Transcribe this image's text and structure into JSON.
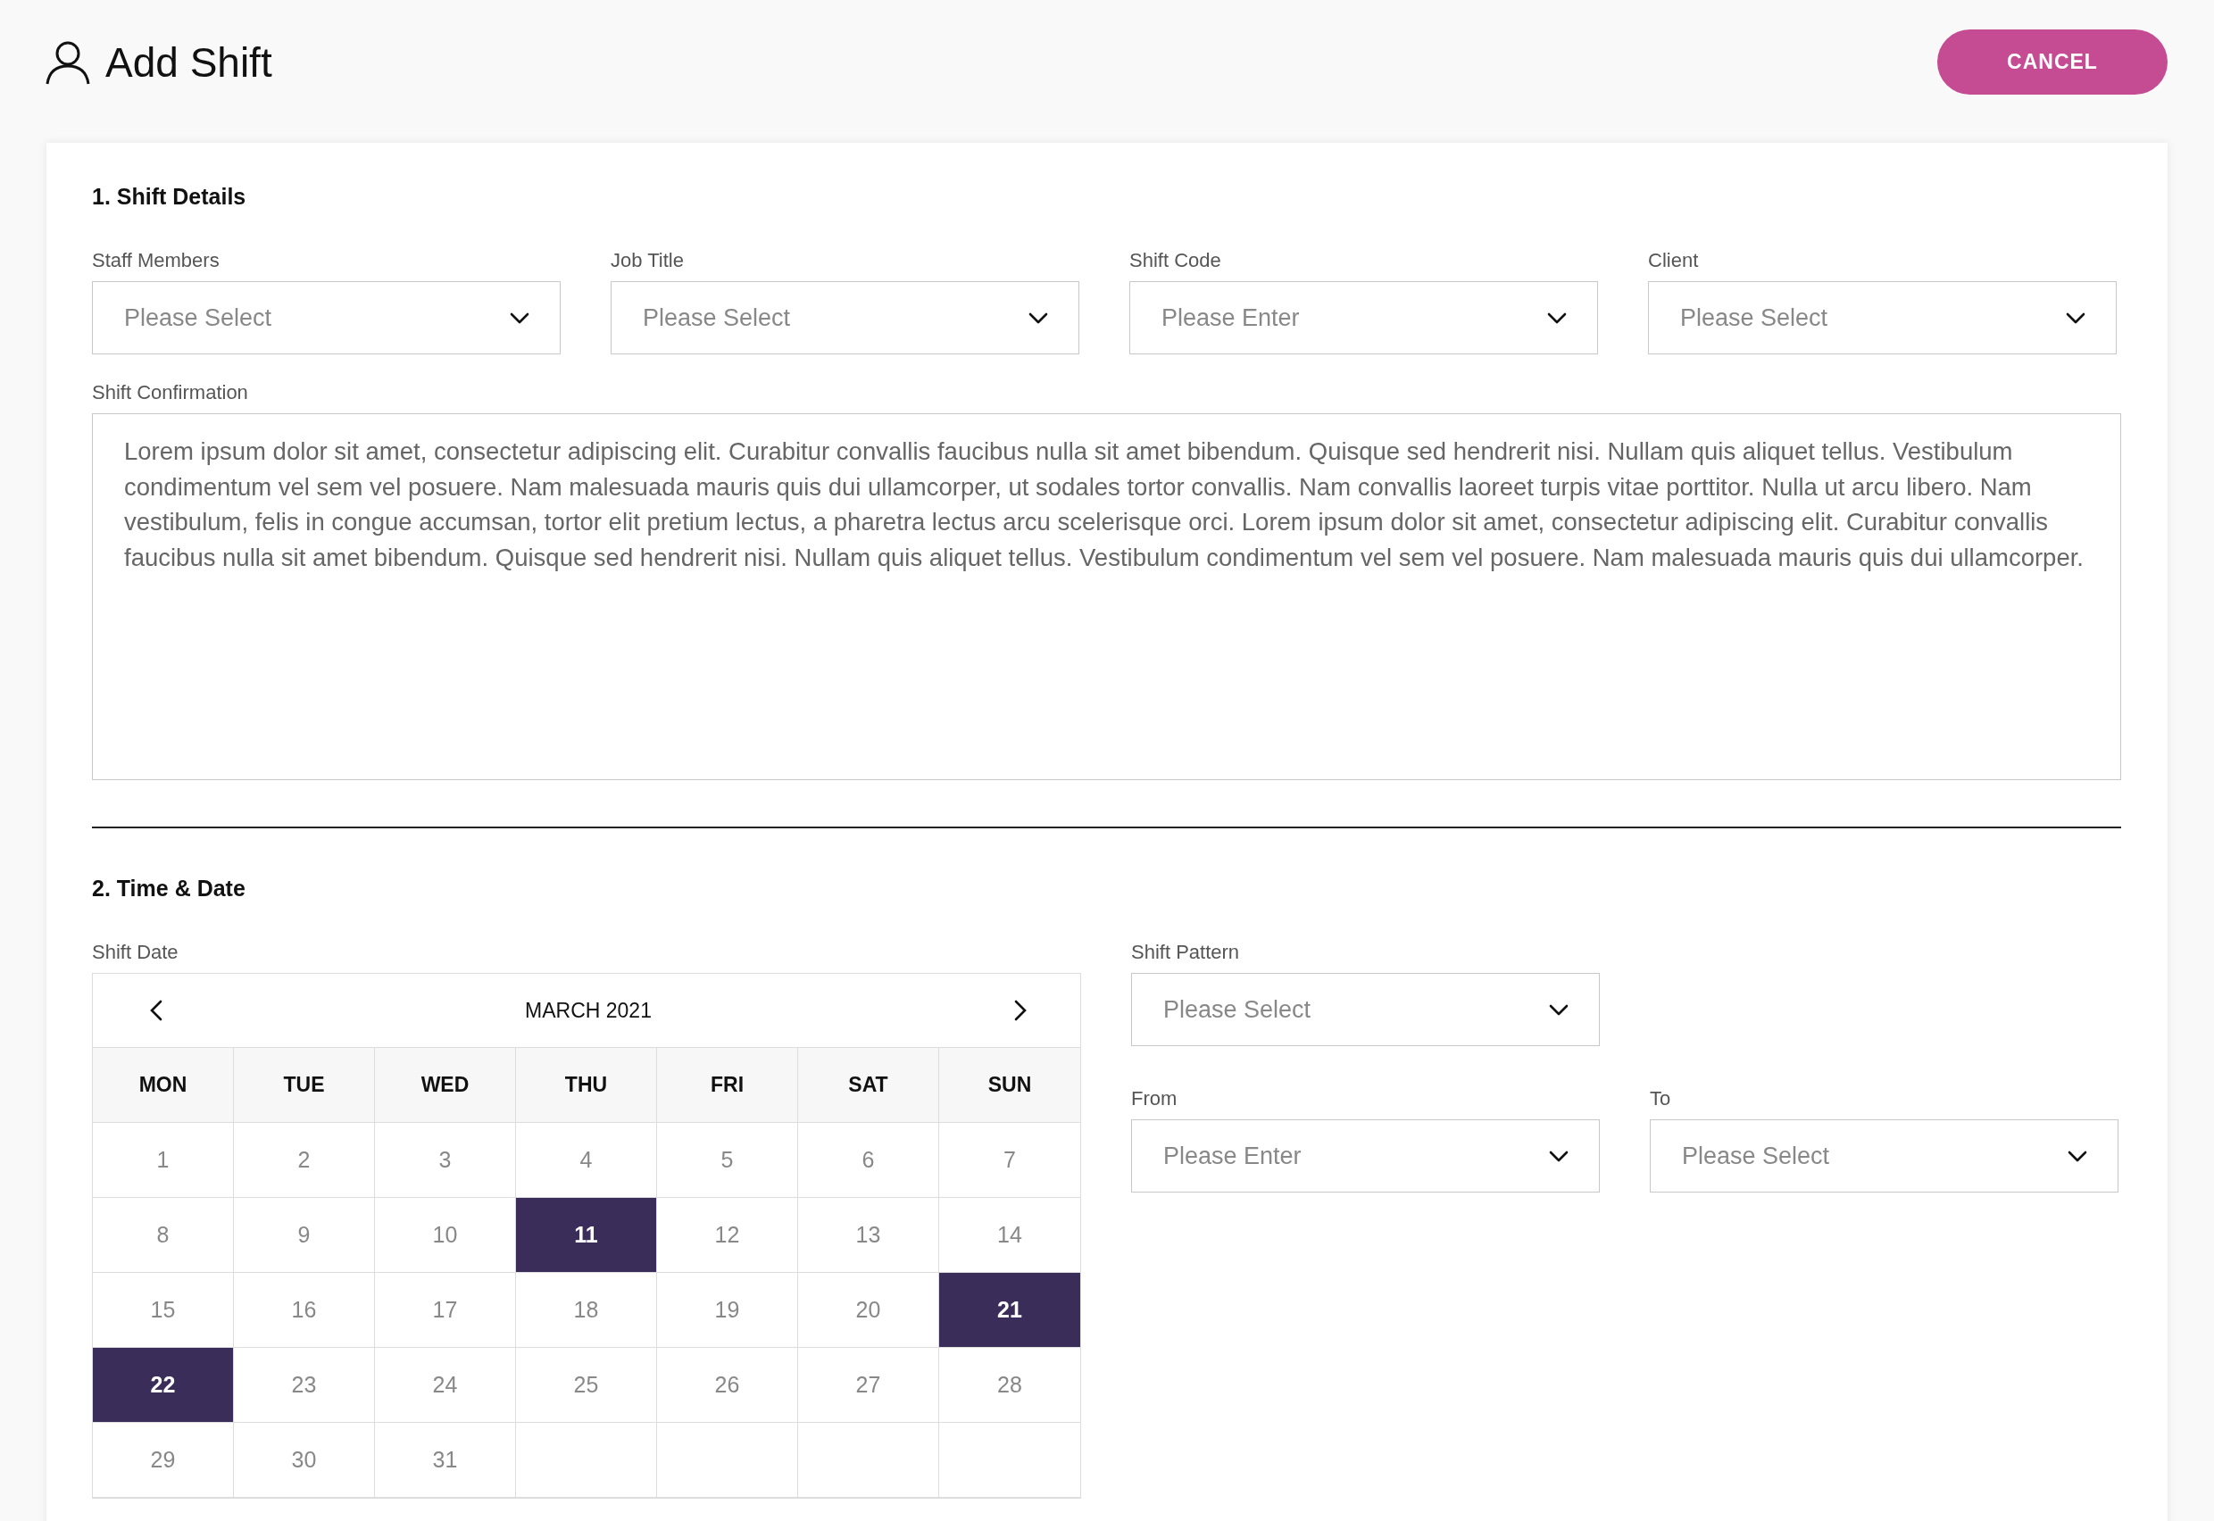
{
  "header": {
    "title": "Add Shift",
    "cancel_button": "CANCEL"
  },
  "shift_details": {
    "title": "1. Shift Details",
    "fields": [
      {
        "label": "Staff Members",
        "placeholder": "Please Select"
      },
      {
        "label": "Job Title",
        "placeholder": "Please Select"
      },
      {
        "label": "Shift Code",
        "placeholder": "Please Enter"
      },
      {
        "label": "Client",
        "placeholder": "Please Select"
      }
    ],
    "confirmation": {
      "label": "Shift Confirmation",
      "value": "Lorem ipsum dolor sit amet, consectetur adipiscing elit. Curabitur convallis faucibus nulla sit amet bibendum. Quisque sed hendrerit nisi. Nullam quis aliquet tellus. Vestibulum condimentum vel sem vel posuere. Nam malesuada mauris quis dui ullamcorper, ut sodales tortor convallis. Nam convallis laoreet turpis vitae porttitor. Nulla ut arcu libero. Nam vestibulum, felis in congue accumsan, tortor elit pretium lectus, a pharetra lectus arcu scelerisque orci. Lorem ipsum dolor sit amet, consectetur adipiscing elit. Curabitur convallis faucibus nulla sit amet bibendum. Quisque sed hendrerit nisi. Nullam quis aliquet tellus. Vestibulum condimentum vel sem vel posuere. Nam malesuada mauris quis dui ullamcorper."
    }
  },
  "time_date": {
    "title": "2. Time & Date",
    "calendar": {
      "label": "Shift Date",
      "month": "MARCH 2021",
      "weekdays": [
        "MON",
        "TUE",
        "WED",
        "THU",
        "FRI",
        "SAT",
        "SUN"
      ],
      "weeks": [
        [
          {
            "day": "1",
            "selected": false
          },
          {
            "day": "2",
            "selected": false
          },
          {
            "day": "3",
            "selected": false
          },
          {
            "day": "4",
            "selected": false
          },
          {
            "day": "5",
            "selected": false
          },
          {
            "day": "6",
            "selected": false
          },
          {
            "day": "7",
            "selected": false
          }
        ],
        [
          {
            "day": "8",
            "selected": false
          },
          {
            "day": "9",
            "selected": false
          },
          {
            "day": "10",
            "selected": false
          },
          {
            "day": "11",
            "selected": true
          },
          {
            "day": "12",
            "selected": false
          },
          {
            "day": "13",
            "selected": false
          },
          {
            "day": "14",
            "selected": false
          }
        ],
        [
          {
            "day": "15",
            "selected": false
          },
          {
            "day": "16",
            "selected": false
          },
          {
            "day": "17",
            "selected": false
          },
          {
            "day": "18",
            "selected": false
          },
          {
            "day": "19",
            "selected": false
          },
          {
            "day": "20",
            "selected": false
          },
          {
            "day": "21",
            "selected": true
          }
        ],
        [
          {
            "day": "22",
            "selected": true
          },
          {
            "day": "23",
            "selected": false
          },
          {
            "day": "24",
            "selected": false
          },
          {
            "day": "25",
            "selected": false
          },
          {
            "day": "26",
            "selected": false
          },
          {
            "day": "27",
            "selected": false
          },
          {
            "day": "28",
            "selected": false
          }
        ],
        [
          {
            "day": "29",
            "selected": false
          },
          {
            "day": "30",
            "selected": false
          },
          {
            "day": "31",
            "selected": false
          }
        ]
      ]
    },
    "shift_pattern": {
      "label": "Shift Pattern",
      "placeholder": "Please Select"
    },
    "from": {
      "label": "From",
      "placeholder": "Please Enter"
    },
    "to": {
      "label": "To",
      "placeholder": "Please Select"
    }
  }
}
